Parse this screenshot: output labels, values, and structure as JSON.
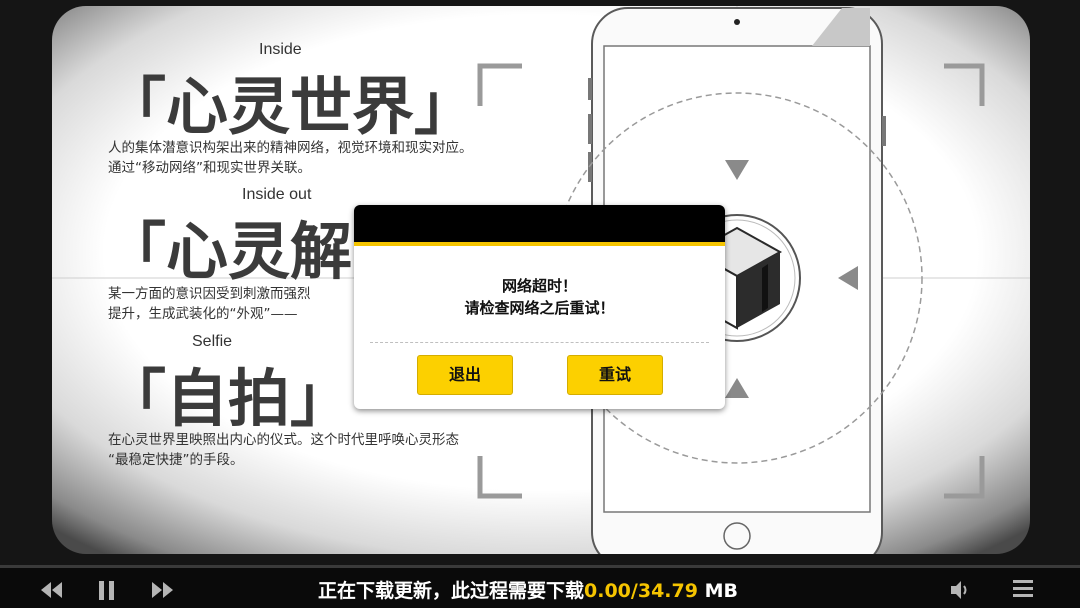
{
  "titles": [
    {
      "en": "Inside",
      "zh": "「心灵世界」",
      "desc": [
        "人的集体潜意识构架出来的精神网络，视觉环境和现实对应。",
        "通过“移动网络”和现实世界关联。"
      ]
    },
    {
      "en": "Inside out",
      "zh": "「心灵解",
      "desc": [
        "某一方面的意识因受到刺激而强烈",
        "提升，生成武装化的“外观”——"
      ]
    },
    {
      "en": "Selfie",
      "zh": "「自拍」",
      "desc": [
        "在心灵世界里映照出内心的仪式。这个时代里呼唤心灵形态",
        "“最稳定快捷”的手段。"
      ]
    }
  ],
  "dialog": {
    "line1": "网络超时！",
    "line2": "请检查网络之后重试！",
    "exit_label": "退出",
    "retry_label": "重试"
  },
  "status": {
    "prefix": "正在下载更新，此过程需要下载",
    "downloaded": "0.00",
    "separator": "/",
    "total": "34.79",
    "unit": " MB",
    "progress": 0
  },
  "controls": [
    "rewind-icon",
    "pause-icon",
    "fast-forward-icon",
    "volume-icon",
    "menu-icon"
  ],
  "colors": {
    "accent": "#f5c400",
    "button": "#fcd000",
    "dialog_header": "#000000"
  }
}
